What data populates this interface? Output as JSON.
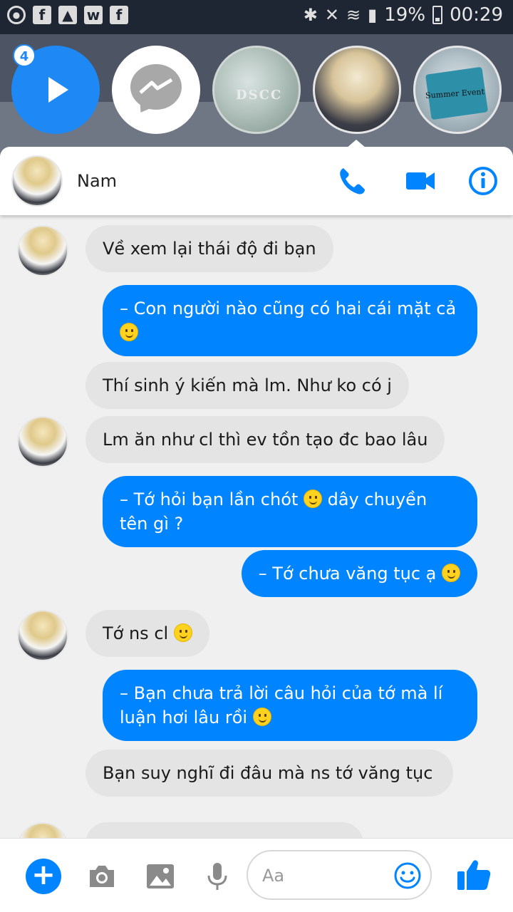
{
  "status_bar": {
    "battery_percent": "19%",
    "time": "00:29",
    "icons": [
      "messenger-head-icon",
      "facebook-icon",
      "gallery-icon",
      "webtoon-icon",
      "facebook-icon",
      "bluetooth-icon",
      "mute-icon",
      "wifi-icon",
      "signal-icon",
      "battery-icon"
    ]
  },
  "chat_heads": {
    "badge_count": "4",
    "head_labels": [
      "",
      "",
      "DSCC",
      "",
      "Summer Event"
    ]
  },
  "header": {
    "contact_name": "Nam"
  },
  "messages": [
    {
      "side": "in",
      "avatar": true,
      "text": "Về xem lại thái độ đi bạn",
      "emoji": false
    },
    {
      "side": "out",
      "text": "– Con người nào cũng có hai cái mặt cả",
      "emoji": true
    },
    {
      "side": "in",
      "avatar": false,
      "text": "Thí sinh ý kiến mà lm. Như ko có j",
      "emoji": false
    },
    {
      "side": "in",
      "avatar": true,
      "text": "Lm ăn như cl thì ev tồn tạo đc bao lâu",
      "emoji": false
    },
    {
      "side": "out",
      "text_a": "– Tớ hỏi bạn lần chót",
      "text_b": "dây chuyền tên gì ?",
      "emoji": true
    },
    {
      "side": "out",
      "text": "– Tớ chưa văng tục ạ",
      "emoji": true
    },
    {
      "side": "in",
      "avatar": true,
      "text": "Tớ ns cl",
      "emoji": true
    },
    {
      "side": "out",
      "text": "– Bạn chưa trả lời câu hỏi của tớ mà lí luận hơi lâu rồi",
      "emoji": true
    },
    {
      "side": "in",
      "avatar": false,
      "text": "Bạn suy nghĩ đi đâu mà ns tớ văng tục",
      "emoji": false
    }
  ],
  "composer": {
    "placeholder": "Aa"
  },
  "colors": {
    "accent": "#0084ff",
    "incoming_bubble": "#e4e4e4",
    "outgoing_bubble": "#0084ff"
  }
}
